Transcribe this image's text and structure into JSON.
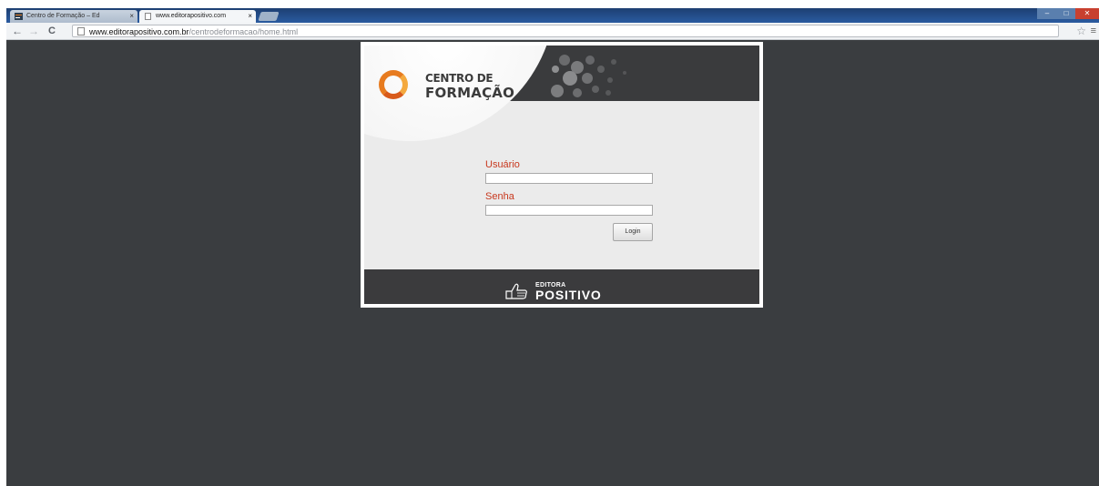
{
  "browser": {
    "tabs": [
      {
        "title": "Centro de Formação – Ed",
        "active": false
      },
      {
        "title": "www.editorapositivo.com",
        "active": true
      }
    ],
    "close_glyph": "×",
    "url_host": "www.editorapositivo.com.br",
    "url_path": "/centrodeformacao/home.html",
    "nav": {
      "back": "←",
      "forward": "→",
      "reload": "C"
    },
    "window_controls": {
      "minimize": "–",
      "maximize": "□",
      "close": "✕"
    },
    "bookmark_star": "☆",
    "menu_glyph": "≡"
  },
  "header": {
    "logo_line1": "CENTRO DE",
    "logo_line2": "FORMAÇÃO"
  },
  "form": {
    "username_label": "Usuário",
    "username_value": "",
    "password_label": "Senha",
    "password_value": "",
    "login_label": "Login"
  },
  "footer": {
    "brand_small": "EDITORA",
    "brand_big": "POSITIVO"
  },
  "colors": {
    "page_background": "#3a3d40",
    "label_red": "#c8381e",
    "logo_orange": "#e77b1f",
    "dark_band": "#3a3b3d"
  }
}
